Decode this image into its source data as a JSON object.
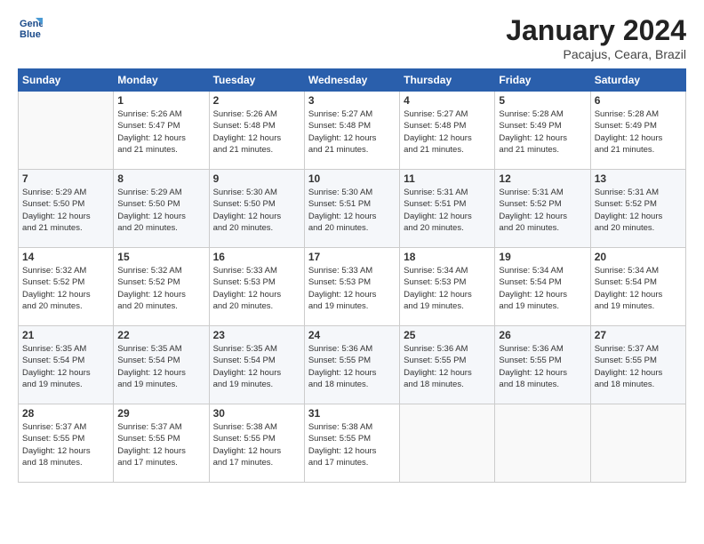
{
  "header": {
    "logo_line1": "General",
    "logo_line2": "Blue",
    "title": "January 2024",
    "location": "Pacajus, Ceara, Brazil"
  },
  "days_of_week": [
    "Sunday",
    "Monday",
    "Tuesday",
    "Wednesday",
    "Thursday",
    "Friday",
    "Saturday"
  ],
  "weeks": [
    [
      {
        "day": "",
        "empty": true
      },
      {
        "day": "1",
        "sunrise": "5:26 AM",
        "sunset": "5:47 PM",
        "daylight": "12 hours and 21 minutes."
      },
      {
        "day": "2",
        "sunrise": "5:26 AM",
        "sunset": "5:48 PM",
        "daylight": "12 hours and 21 minutes."
      },
      {
        "day": "3",
        "sunrise": "5:27 AM",
        "sunset": "5:48 PM",
        "daylight": "12 hours and 21 minutes."
      },
      {
        "day": "4",
        "sunrise": "5:27 AM",
        "sunset": "5:48 PM",
        "daylight": "12 hours and 21 minutes."
      },
      {
        "day": "5",
        "sunrise": "5:28 AM",
        "sunset": "5:49 PM",
        "daylight": "12 hours and 21 minutes."
      },
      {
        "day": "6",
        "sunrise": "5:28 AM",
        "sunset": "5:49 PM",
        "daylight": "12 hours and 21 minutes."
      }
    ],
    [
      {
        "day": "7",
        "sunrise": "5:29 AM",
        "sunset": "5:50 PM",
        "daylight": "12 hours and 21 minutes."
      },
      {
        "day": "8",
        "sunrise": "5:29 AM",
        "sunset": "5:50 PM",
        "daylight": "12 hours and 20 minutes."
      },
      {
        "day": "9",
        "sunrise": "5:30 AM",
        "sunset": "5:50 PM",
        "daylight": "12 hours and 20 minutes."
      },
      {
        "day": "10",
        "sunrise": "5:30 AM",
        "sunset": "5:51 PM",
        "daylight": "12 hours and 20 minutes."
      },
      {
        "day": "11",
        "sunrise": "5:31 AM",
        "sunset": "5:51 PM",
        "daylight": "12 hours and 20 minutes."
      },
      {
        "day": "12",
        "sunrise": "5:31 AM",
        "sunset": "5:52 PM",
        "daylight": "12 hours and 20 minutes."
      },
      {
        "day": "13",
        "sunrise": "5:31 AM",
        "sunset": "5:52 PM",
        "daylight": "12 hours and 20 minutes."
      }
    ],
    [
      {
        "day": "14",
        "sunrise": "5:32 AM",
        "sunset": "5:52 PM",
        "daylight": "12 hours and 20 minutes."
      },
      {
        "day": "15",
        "sunrise": "5:32 AM",
        "sunset": "5:52 PM",
        "daylight": "12 hours and 20 minutes."
      },
      {
        "day": "16",
        "sunrise": "5:33 AM",
        "sunset": "5:53 PM",
        "daylight": "12 hours and 20 minutes."
      },
      {
        "day": "17",
        "sunrise": "5:33 AM",
        "sunset": "5:53 PM",
        "daylight": "12 hours and 19 minutes."
      },
      {
        "day": "18",
        "sunrise": "5:34 AM",
        "sunset": "5:53 PM",
        "daylight": "12 hours and 19 minutes."
      },
      {
        "day": "19",
        "sunrise": "5:34 AM",
        "sunset": "5:54 PM",
        "daylight": "12 hours and 19 minutes."
      },
      {
        "day": "20",
        "sunrise": "5:34 AM",
        "sunset": "5:54 PM",
        "daylight": "12 hours and 19 minutes."
      }
    ],
    [
      {
        "day": "21",
        "sunrise": "5:35 AM",
        "sunset": "5:54 PM",
        "daylight": "12 hours and 19 minutes."
      },
      {
        "day": "22",
        "sunrise": "5:35 AM",
        "sunset": "5:54 PM",
        "daylight": "12 hours and 19 minutes."
      },
      {
        "day": "23",
        "sunrise": "5:35 AM",
        "sunset": "5:54 PM",
        "daylight": "12 hours and 19 minutes."
      },
      {
        "day": "24",
        "sunrise": "5:36 AM",
        "sunset": "5:55 PM",
        "daylight": "12 hours and 18 minutes."
      },
      {
        "day": "25",
        "sunrise": "5:36 AM",
        "sunset": "5:55 PM",
        "daylight": "12 hours and 18 minutes."
      },
      {
        "day": "26",
        "sunrise": "5:36 AM",
        "sunset": "5:55 PM",
        "daylight": "12 hours and 18 minutes."
      },
      {
        "day": "27",
        "sunrise": "5:37 AM",
        "sunset": "5:55 PM",
        "daylight": "12 hours and 18 minutes."
      }
    ],
    [
      {
        "day": "28",
        "sunrise": "5:37 AM",
        "sunset": "5:55 PM",
        "daylight": "12 hours and 18 minutes."
      },
      {
        "day": "29",
        "sunrise": "5:37 AM",
        "sunset": "5:55 PM",
        "daylight": "12 hours and 17 minutes."
      },
      {
        "day": "30",
        "sunrise": "5:38 AM",
        "sunset": "5:55 PM",
        "daylight": "12 hours and 17 minutes."
      },
      {
        "day": "31",
        "sunrise": "5:38 AM",
        "sunset": "5:55 PM",
        "daylight": "12 hours and 17 minutes."
      },
      {
        "day": "",
        "empty": true
      },
      {
        "day": "",
        "empty": true
      },
      {
        "day": "",
        "empty": true
      }
    ]
  ],
  "labels": {
    "sunrise": "Sunrise:",
    "sunset": "Sunset:",
    "daylight": "Daylight:"
  }
}
